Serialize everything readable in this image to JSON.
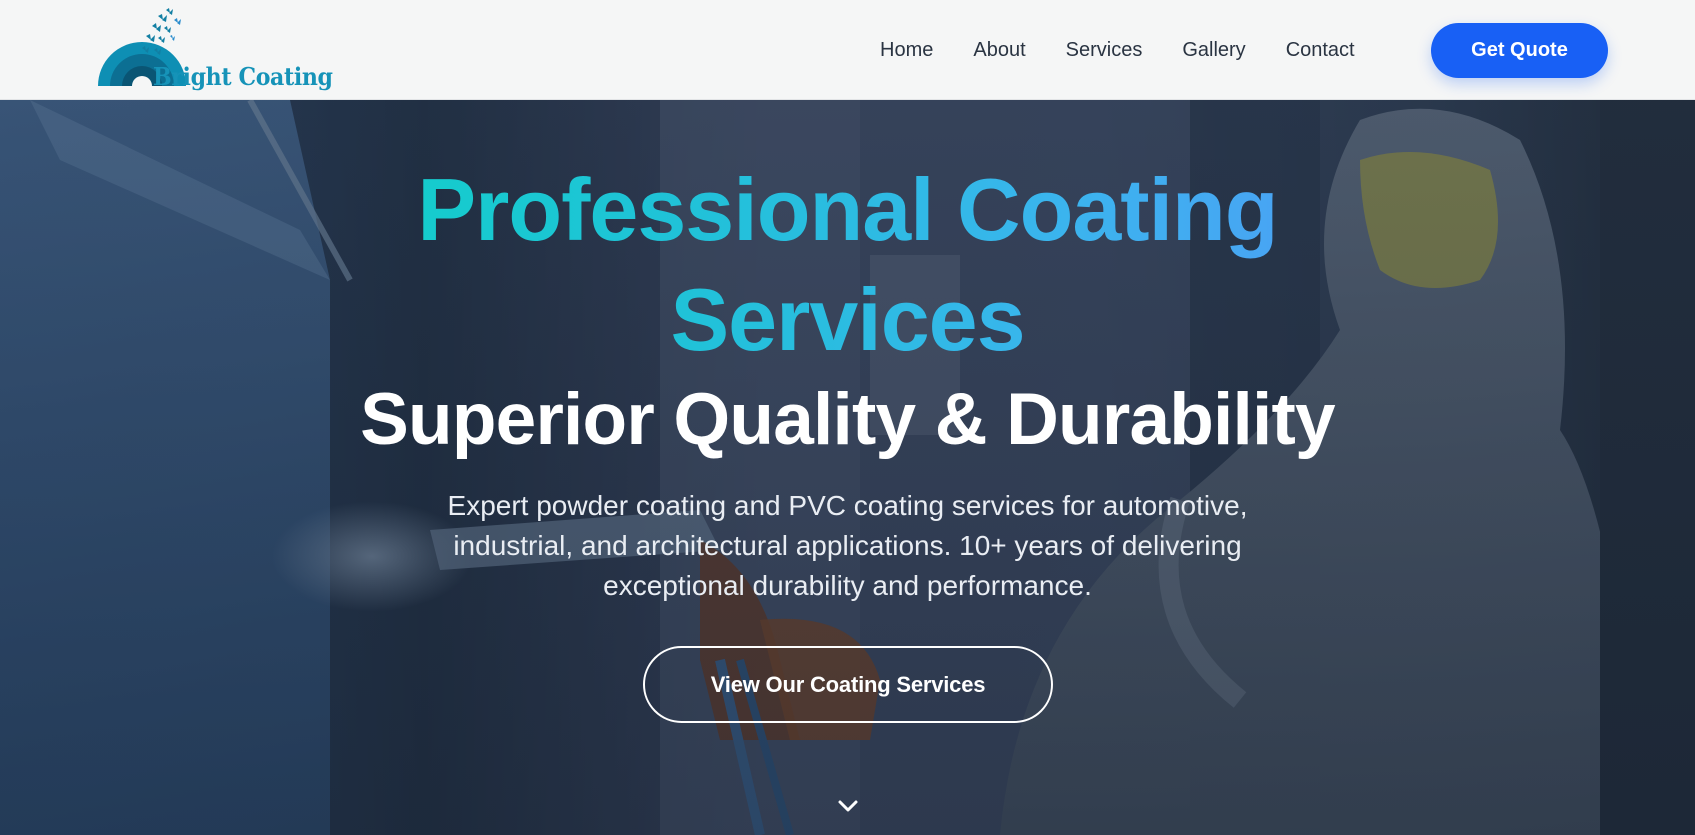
{
  "brand": {
    "name": "Bright Coating",
    "logo_icon": "rainbow-arch-with-butterflies",
    "text_color": "#1693b8"
  },
  "nav": {
    "items": [
      "Home",
      "About",
      "Services",
      "Gallery",
      "Contact"
    ],
    "cta_label": "Get Quote"
  },
  "hero": {
    "title": "Professional Coating Services",
    "subtitle": "Superior Quality & Durability",
    "description": "Expert powder coating and PVC coating services for automotive, industrial, and architectural applications. 10+ years of delivering exceptional durability and performance.",
    "button_label": "View Our Coating Services",
    "scroll_icon": "chevron-down-icon",
    "background_image": "worker-in-protective-suit-powder-coating"
  },
  "colors": {
    "primary": "#1860f5",
    "title_gradient_start": "#10d0c8",
    "title_gradient_end": "#4f9cf6",
    "header_bg": "#f5f6f6",
    "nav_text": "#2a3442"
  }
}
